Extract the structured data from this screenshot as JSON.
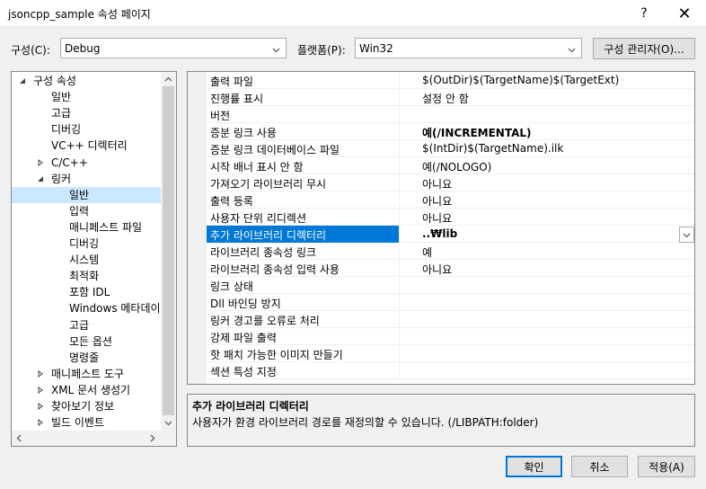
{
  "window": {
    "title": "jsoncpp_sample 속성 페이지",
    "help": "?",
    "close": "✕"
  },
  "config_row": {
    "config_label": "구성(C):",
    "config_value": "Debug",
    "platform_label": "플랫폼(P):",
    "platform_value": "Win32",
    "manager_button": "구성 관리자(O)..."
  },
  "tree": {
    "items": [
      {
        "label": "구성 속성",
        "expander": "expanded"
      },
      {
        "label": "일반",
        "expander": "none"
      },
      {
        "label": "고급",
        "expander": "none"
      },
      {
        "label": "디버깅",
        "expander": "none"
      },
      {
        "label": "VC++ 디렉터리",
        "expander": "none"
      },
      {
        "label": "C/C++",
        "expander": "collapsed"
      },
      {
        "label": "링커",
        "expander": "expanded"
      },
      {
        "label": "일반",
        "expander": "none",
        "selected": true
      },
      {
        "label": "입력",
        "expander": "none"
      },
      {
        "label": "매니페스트 파일",
        "expander": "none"
      },
      {
        "label": "디버깅",
        "expander": "none"
      },
      {
        "label": "시스템",
        "expander": "none"
      },
      {
        "label": "최적화",
        "expander": "none"
      },
      {
        "label": "포함 IDL",
        "expander": "none"
      },
      {
        "label": "Windows 메타데이",
        "expander": "none"
      },
      {
        "label": "고급",
        "expander": "none"
      },
      {
        "label": "모든 옵션",
        "expander": "none"
      },
      {
        "label": "명령줄",
        "expander": "none"
      },
      {
        "label": "매니페스트 도구",
        "expander": "collapsed"
      },
      {
        "label": "XML 문서 생성기",
        "expander": "collapsed"
      },
      {
        "label": "찾아보기 정보",
        "expander": "collapsed"
      },
      {
        "label": "빌드 이벤트",
        "expander": "collapsed"
      }
    ]
  },
  "properties": [
    {
      "name": "출력 파일",
      "value": "$(OutDir)$(TargetName)$(TargetExt)"
    },
    {
      "name": "진행률 표시",
      "value": "설정 안 함"
    },
    {
      "name": "버전",
      "value": ""
    },
    {
      "name": "증분 링크 사용",
      "value": "예(/INCREMENTAL)",
      "bold": true
    },
    {
      "name": "증분 링크 데이터베이스 파일",
      "value": "$(IntDir)$(TargetName).ilk"
    },
    {
      "name": "시작 배너 표시 안 함",
      "value": "예(/NOLOGO)"
    },
    {
      "name": "가져오기 라이브러리 무시",
      "value": "아니요"
    },
    {
      "name": "출력 등록",
      "value": "아니요"
    },
    {
      "name": "사용자 단위 리디렉션",
      "value": "아니요"
    },
    {
      "name": "추가 라이브러리 디렉터리",
      "value": "..₩lib",
      "bold": true,
      "selected": true
    },
    {
      "name": "라이브러리 종속성 링크",
      "value": "예"
    },
    {
      "name": "라이브러리 종속성 입력 사용",
      "value": "아니요"
    },
    {
      "name": "링크 상태",
      "value": ""
    },
    {
      "name": "Dll 바인딩 방지",
      "value": ""
    },
    {
      "name": "링커 경고를 오류로 처리",
      "value": ""
    },
    {
      "name": "강제 파일 출력",
      "value": ""
    },
    {
      "name": "핫 패치 가능한 이미지 만들기",
      "value": ""
    },
    {
      "name": "섹션 특성 지정",
      "value": ""
    }
  ],
  "description": {
    "title": "추가 라이브러리 디렉터리",
    "text": "사용자가 환경 라이브러리 경로를 재정의할 수 있습니다. (/LIBPATH:folder)"
  },
  "buttons": {
    "ok": "확인",
    "cancel": "취소",
    "apply": "적용(A)"
  },
  "colors": {
    "accent": "#0078d7",
    "tree_selection": "#cce8ff"
  }
}
